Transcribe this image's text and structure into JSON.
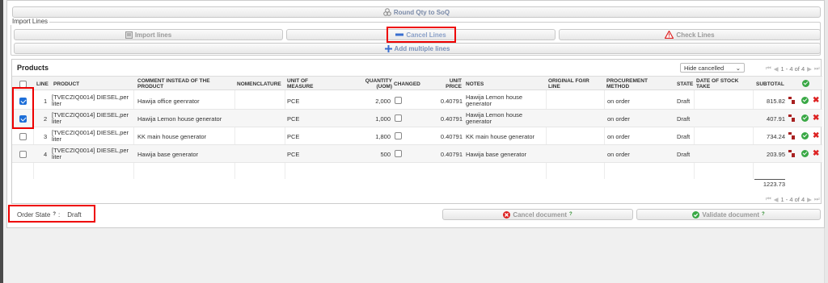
{
  "toolbar": {
    "round_qty": "Round Qty to SoQ"
  },
  "import_lines": {
    "legend": "Import Lines",
    "import_btn": "Import lines",
    "cancel_btn": "Cancel Lines",
    "check_btn": "Check Lines",
    "add_multiple": "Add multiple lines"
  },
  "products": {
    "title": "Products",
    "filter_selected": "Hide cancelled",
    "pager_top": "1 - 4 of 4",
    "pager_bottom": "1 - 4 of 4",
    "headers": {
      "line": "LINE",
      "product": "PRODUCT",
      "comment": "COMMENT INSTEAD OF THE PRODUCT",
      "nomenclature": "NOMENCLATURE",
      "uom": "UNIT OF MEASURE",
      "quantity": "QUANTITY (UOM)",
      "changed": "CHANGED",
      "unit_price": "UNIT PRICE",
      "notes": "NOTES",
      "original_fo": "ORIGINAL FO/IR LINE",
      "procurement": "PROCUREMENT METHOD",
      "state": "STATE",
      "date_stock": "DATE OF STOCK TAKE",
      "subtotal": "SUBTOTAL"
    },
    "rows": [
      {
        "checked": true,
        "line": "1",
        "product": "[TVECZIQ0014] DIESEL,per liter",
        "comment": "Hawija office geenrator",
        "uom": "PCE",
        "quantity": "2,000",
        "unit_price": "0.40791",
        "notes": "Hawija Lemon house generator",
        "procurement": "on order",
        "state": "Draft",
        "subtotal": "815.82"
      },
      {
        "checked": true,
        "line": "2",
        "product": "[TVECZIQ0014] DIESEL,per liter",
        "comment": "Hawija Lemon house generator",
        "uom": "PCE",
        "quantity": "1,000",
        "unit_price": "0.40791",
        "notes": "Hawija Lemon house generator",
        "procurement": "on order",
        "state": "Draft",
        "subtotal": "407.91"
      },
      {
        "checked": false,
        "line": "3",
        "product": "[TVECZIQ0014] DIESEL,per liter",
        "comment": "KK main house generator",
        "uom": "PCE",
        "quantity": "1,800",
        "unit_price": "0.40791",
        "notes": "KK main house generator",
        "procurement": "on order",
        "state": "Draft",
        "subtotal": "734.24"
      },
      {
        "checked": false,
        "line": "4",
        "product": "[TVECZIQ0014] DIESEL,per liter",
        "comment": "Hawija base generator",
        "uom": "PCE",
        "quantity": "500",
        "unit_price": "0.40791",
        "notes": "Hawija base generator",
        "procurement": "on order",
        "state": "Draft",
        "subtotal": "203.95"
      }
    ],
    "total": "1223.73"
  },
  "footer": {
    "order_state_label": "Order State",
    "help_mark": "?",
    "order_state_value": "Draft",
    "cancel_document": "Cancel document",
    "validate_document": "Validate document"
  }
}
